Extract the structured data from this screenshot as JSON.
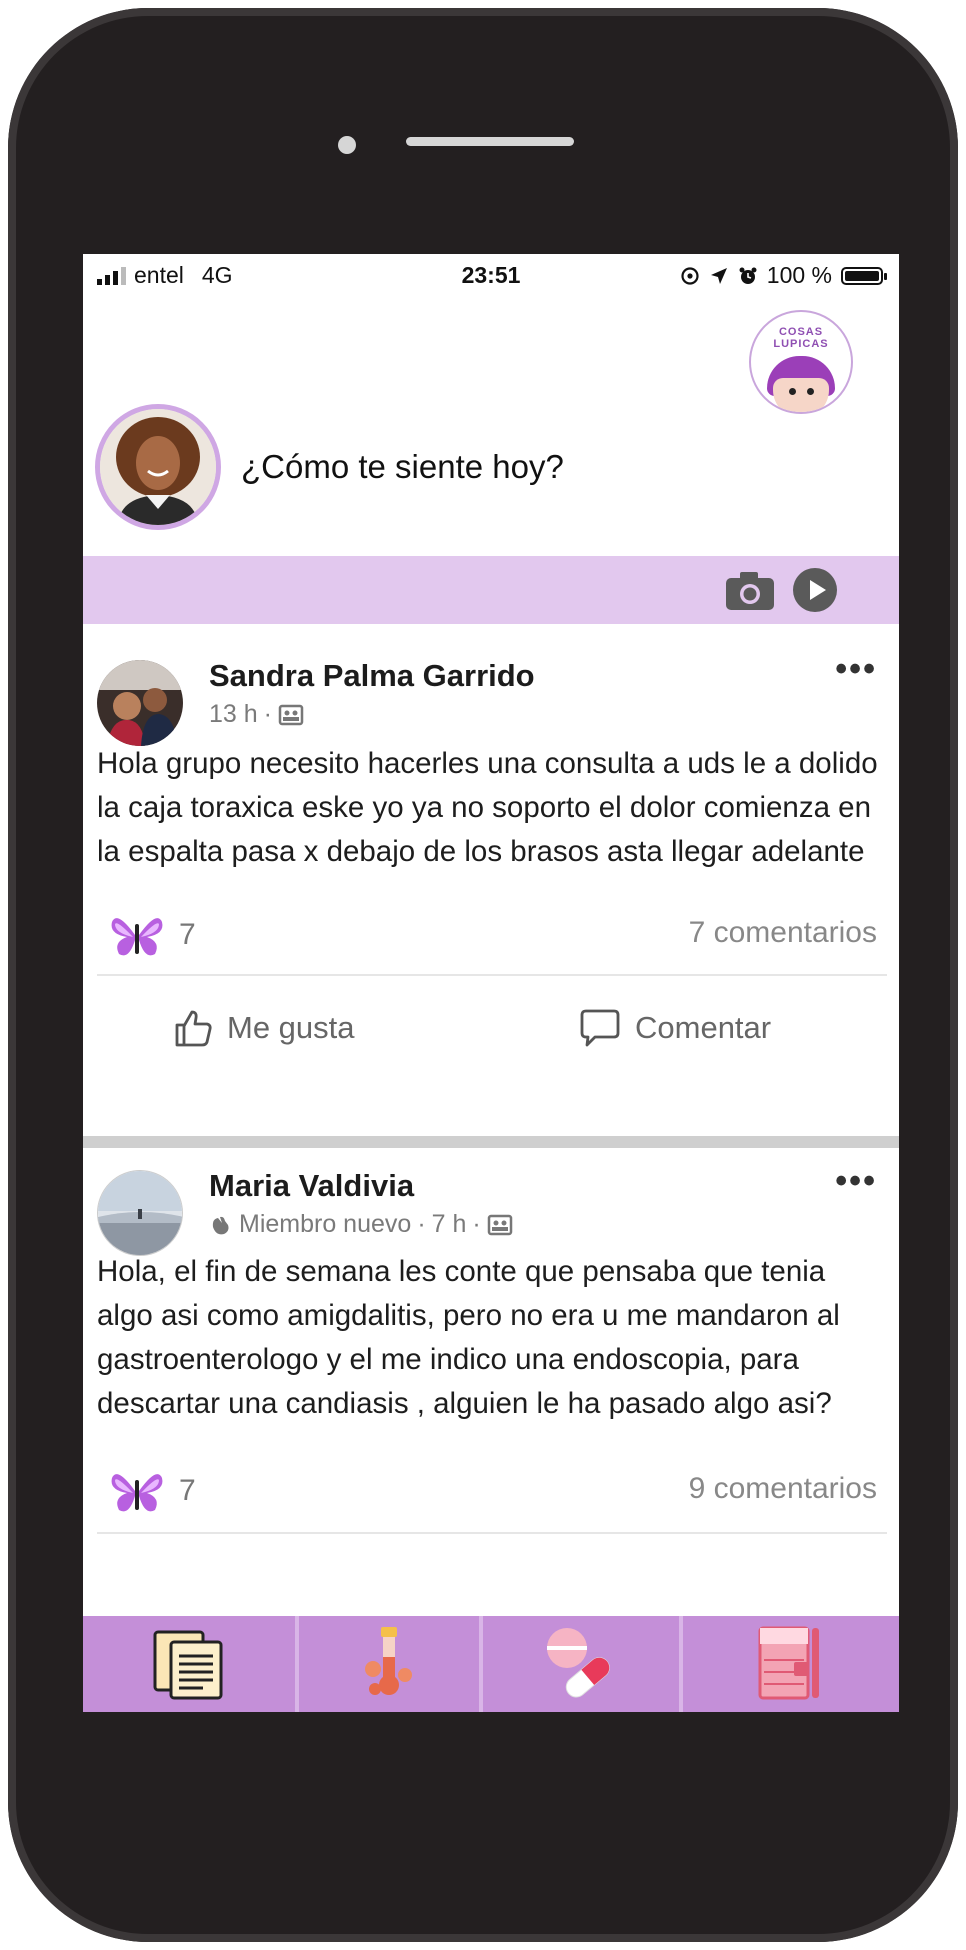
{
  "status_bar": {
    "carrier": "entel",
    "network": "4G",
    "time": "23:51",
    "battery": "100 %"
  },
  "brand": {
    "logo_text_line1": "COSAS",
    "logo_text_line2": "LUPICAS"
  },
  "composer": {
    "prompt": "¿Cómo te siente hoy?"
  },
  "media_bar": {
    "icons": [
      "camera-icon",
      "play-icon"
    ]
  },
  "posts": [
    {
      "author": "Sandra Palma Garrido",
      "time": "13 h",
      "separator": "·",
      "member_badge": "",
      "text": "Hola grupo necesito hacerles una consulta a uds le a dolido la caja toraxica eske yo ya no soporto el dolor comienza en la espalta pasa x debajo de los brasos asta llegar adelante",
      "reaction_count": "7",
      "comments": "7 comentarios",
      "like_label": "Me gusta",
      "comment_label": "Comentar"
    },
    {
      "author": "Maria Valdivia",
      "member_badge": "Miembro nuevo",
      "separator": "·",
      "time": "7 h",
      "text": "Hola, el fin de semana les conte que pensaba que tenia algo asi como amigdalitis, pero no era u me mandaron al gastroenterologo y el me indico una endoscopia, para descartar una candiasis , alguien le ha pasado algo asi?",
      "reaction_count": "7",
      "comments": "9 comentarios"
    }
  ],
  "tab_bar": {
    "tabs": [
      "documents-icon",
      "test-tube-icon",
      "pills-icon",
      "notebook-icon"
    ]
  },
  "colors": {
    "accent_light": "#e2c8ee",
    "accent_tab": "#c48fd8",
    "phone_body": "#231f20"
  }
}
